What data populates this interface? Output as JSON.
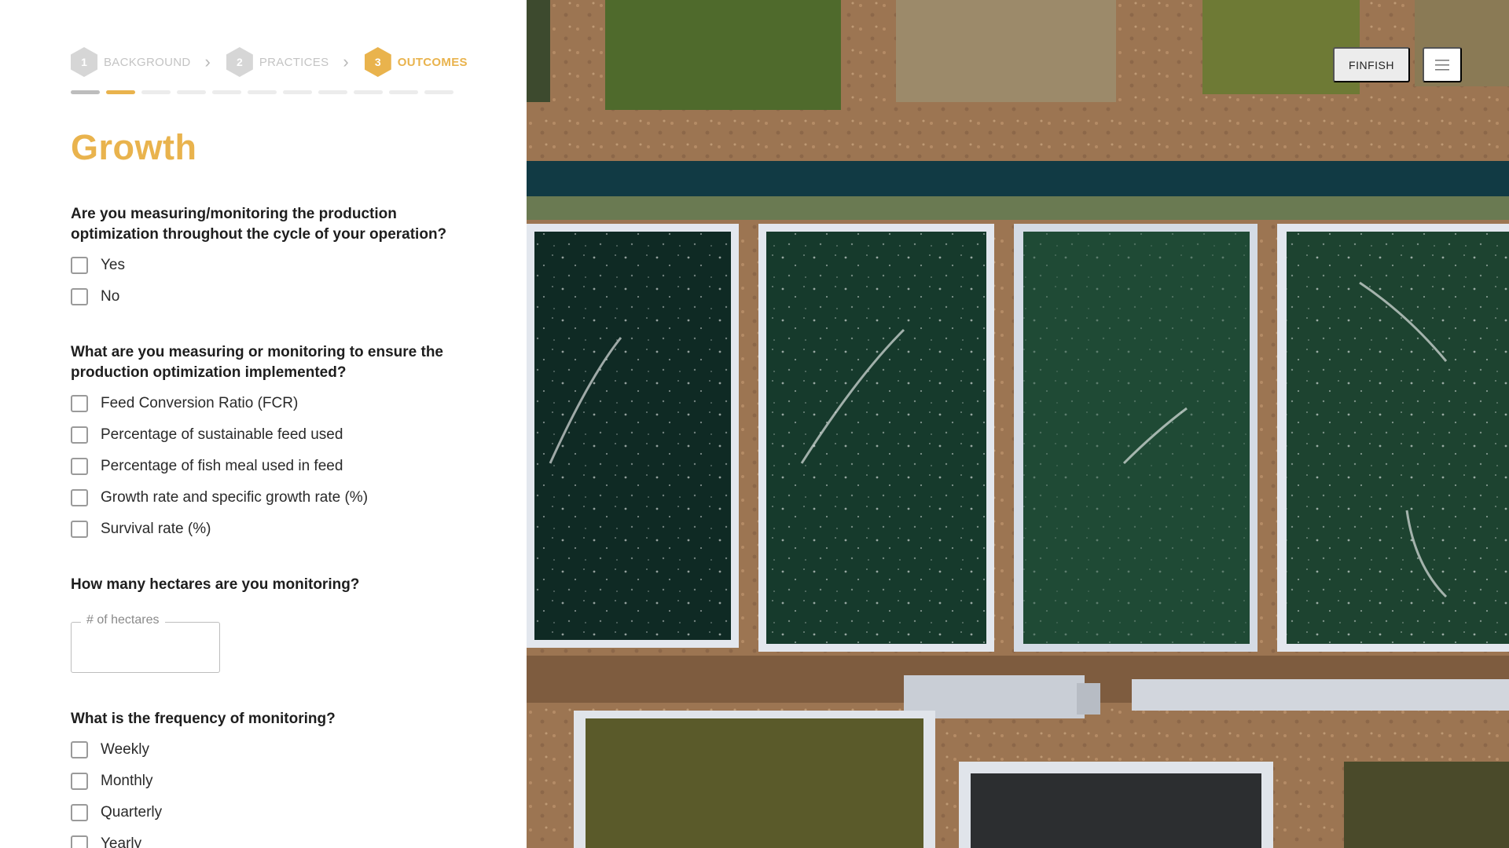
{
  "stepper": {
    "steps": [
      {
        "number": "1",
        "label": "BACKGROUND"
      },
      {
        "number": "2",
        "label": "PRACTICES"
      },
      {
        "number": "3",
        "label": "OUTCOMES"
      }
    ],
    "progress": {
      "total_segments": 11,
      "completed": 1,
      "current_index": 1
    }
  },
  "section": {
    "title": "Growth"
  },
  "questions": {
    "q1": {
      "text": "Are you measuring/monitoring the production optimization throughout the cycle of your operation?",
      "options": [
        "Yes",
        "No"
      ]
    },
    "q2": {
      "text": "What are you measuring or monitoring to ensure the production optimization implemented?",
      "options": [
        "Feed Conversion Ratio (FCR)",
        "Percentage of sustainable feed used",
        "Percentage of fish meal used in feed",
        "Growth rate and specific growth rate (%)",
        "Survival rate (%)"
      ]
    },
    "q3": {
      "text": "How many hectares are you monitoring?",
      "field_label": "# of hectares",
      "value": ""
    },
    "q4": {
      "text": "What is the frequency of monitoring?",
      "options": [
        "Weekly",
        "Monthly",
        "Quarterly",
        "Yearly"
      ]
    }
  },
  "topbar": {
    "finish_label": "FINFISH",
    "menu_icon": "hamburger-menu-icon"
  },
  "colors": {
    "accent": "#e9b34d",
    "step_inactive": "#d6d6d6",
    "pond_dark": "#0f2a24",
    "pond_green": "#1f4a35",
    "levee": "#b8835c"
  }
}
